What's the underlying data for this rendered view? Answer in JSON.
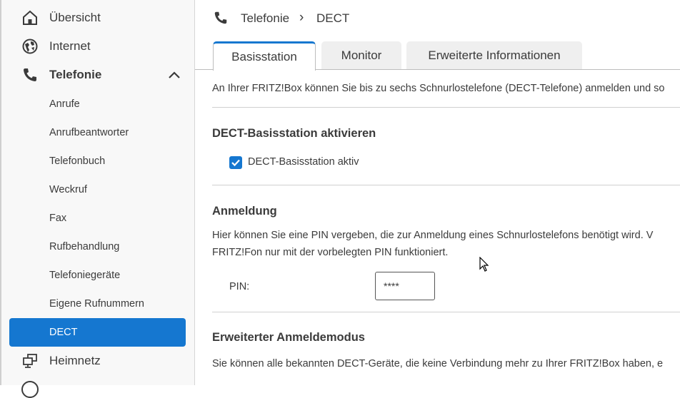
{
  "sidebar": {
    "items": [
      {
        "label": "Übersicht",
        "icon": "home-icon"
      },
      {
        "label": "Internet",
        "icon": "globe-icon"
      },
      {
        "label": "Telefonie",
        "icon": "phone-icon"
      }
    ],
    "sub_items": [
      "Anrufe",
      "Anrufbeantworter",
      "Telefonbuch",
      "Weckruf",
      "Fax",
      "Rufbehandlung",
      "Telefoniegeräte",
      "Eigene Rufnummern",
      "DECT"
    ],
    "after_items": [
      {
        "label": "Heimnetz",
        "icon": "network-icon"
      }
    ],
    "accent": "#1577d0"
  },
  "breadcrumb": {
    "parent": "Telefonie",
    "separator": "›",
    "current": "DECT"
  },
  "tabs": [
    "Basisstation",
    "Monitor",
    "Erweiterte Informationen"
  ],
  "content": {
    "intro": "An Ihrer FRITZ!Box können Sie bis zu sechs Schnurlostelefone (DECT-Telefone) anmelden und so",
    "section1": {
      "title": "DECT-Basisstation aktivieren",
      "checkbox_label": "DECT-Basisstation aktiv",
      "checked": true
    },
    "section2": {
      "title": "Anmeldung",
      "line1": "Hier können Sie eine PIN vergeben, die zur Anmeldung eines Schnurlostelefons benötigt wird. V",
      "line2": "FRITZ!Fon nur mit der vorbelegten PIN funktioniert.",
      "pin_label": "PIN:",
      "pin_value": "****"
    },
    "section3": {
      "title": "Erweiterter Anmeldemodus",
      "line1": "Sie können alle bekannten DECT-Geräte, die keine Verbindung mehr zu Ihrer FRITZ!Box haben, e"
    }
  }
}
